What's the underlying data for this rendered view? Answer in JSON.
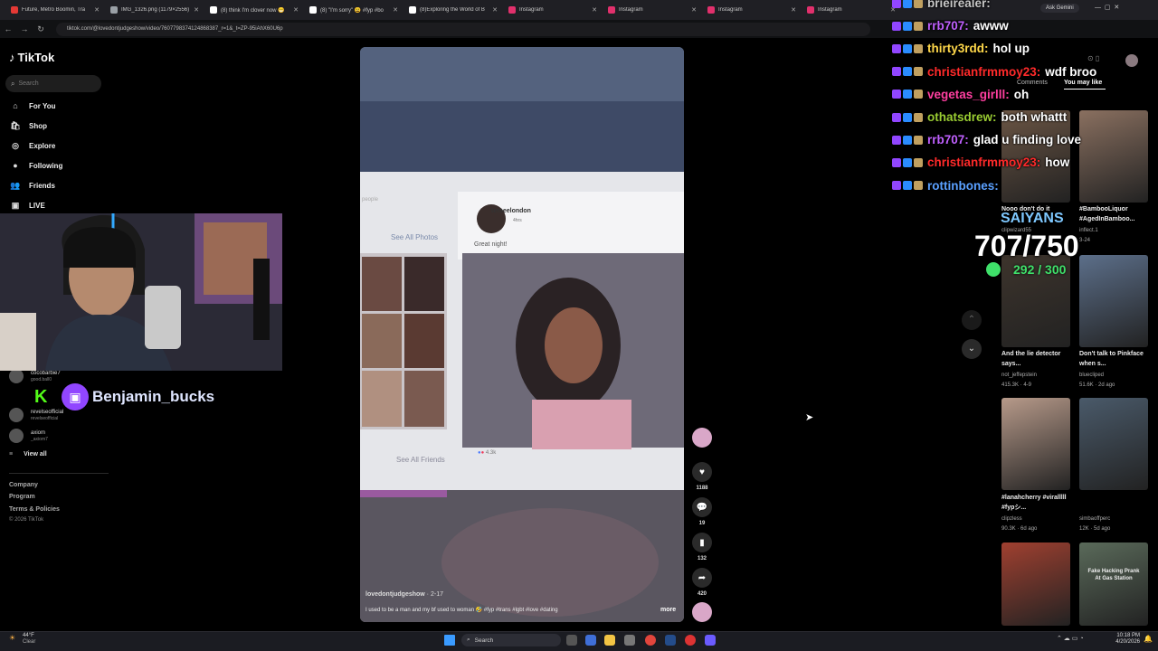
{
  "browser": {
    "tabs": [
      {
        "title": "Future, Metro Boomin, Tra",
        "color": "#e53935"
      },
      {
        "title": "IMG_1326.png (1179×2556)",
        "color": "#9aa0a6"
      },
      {
        "title": "(8) think I'm clover now 😁",
        "color": "#ffffff"
      },
      {
        "title": "(8) \"I'm sorry\" 😩 #fyp #bo",
        "color": "#ffffff"
      },
      {
        "title": "(8)Exploring the World of B",
        "color": "#ffffff"
      },
      {
        "title": "Instagram",
        "color": "#e1306c"
      },
      {
        "title": "Instagram",
        "color": "#e1306c"
      },
      {
        "title": "Instagram",
        "color": "#e1306c"
      },
      {
        "title": "Instagram",
        "color": "#e1306c"
      }
    ],
    "url": "tiktok.com/@lovedontjudgeshow/video/7607798374124868387_r=1&_t=ZP-95iAhX60U6p",
    "ask_gemini": "Ask Gemini"
  },
  "tiktok": {
    "logo": "TikTok",
    "search_placeholder": "Search",
    "nav": [
      {
        "label": "For You",
        "icon": "⌂"
      },
      {
        "label": "Shop",
        "icon": "🛍"
      },
      {
        "label": "Explore",
        "icon": "◎"
      },
      {
        "label": "Following",
        "icon": "●"
      },
      {
        "label": "Friends",
        "icon": "👥"
      },
      {
        "label": "LIVE",
        "icon": "▣"
      }
    ],
    "accounts": [
      {
        "name": "cocobarbie7",
        "sub": "good.ball0"
      },
      {
        "name": "revelseofficial",
        "sub": "revelseofficial"
      },
      {
        "name": "axiom",
        "sub": "_axiom7"
      }
    ],
    "view_all": "View all",
    "footer": [
      "Company",
      "Program",
      "Terms & Policies",
      "© 2026 TikTok"
    ]
  },
  "stream": {
    "streamer_name": "Benjamin_bucks",
    "sub_goal_name": "SAIYANS",
    "sub_goal": "707/750",
    "follow_goal": "292 / 300"
  },
  "video": {
    "post_user": "teraeelondon",
    "post_sub": "4hrs",
    "post_caption": "Great night!",
    "see_all_photos": "See All Photos",
    "see_all_friends": "See All Friends",
    "reactions": "4.3k",
    "people": "people",
    "author": "lovedontjudgeshow",
    "date": "2-17",
    "caption": "I used to be a man and my bf used to woman 🤣 #fyp #trans #lgbt #love #dating",
    "more": "more",
    "likes": "1188",
    "comments": "19",
    "saves": "132",
    "shares": "420"
  },
  "right_panel": {
    "tab_comments": "Comments",
    "tab_you_may_like": "You may like",
    "items": [
      {
        "caption": "Nooo don't do it",
        "user": "clipwizard55",
        "stats": "",
        "color": "#6b5544"
      },
      {
        "caption": "#BambooLiquor #AgedInBamboo...",
        "user": "inflect.1",
        "stats": "3-24",
        "color": "#8a7060"
      },
      {
        "caption": "And the lie detector says...",
        "user": "not_jeffepstein",
        "stats": "415.3K · 4-9",
        "color": "#3d342c"
      },
      {
        "caption": "Don't talk to Pinkface when s...",
        "user": "bluecliped",
        "stats": "51.6K · 2d ago",
        "color": "#5c6f8a"
      },
      {
        "caption": "#lanahcherry #viralllll #fypシ...",
        "user": "clipzless",
        "stats": "90.3K · 6d ago",
        "color": "#b79a8a"
      },
      {
        "caption": "",
        "user": "simbaoffperc",
        "stats": "12K · 5d ago",
        "color": "#4a5a6a"
      },
      {
        "caption": "",
        "user": "",
        "stats": "",
        "color": "#a04030"
      },
      {
        "caption": "Fake Hacking Prank At Gas Station",
        "user": "",
        "stats": "",
        "color": "#5a6a5a"
      }
    ]
  },
  "chat": [
    {
      "user": "brieirealer:",
      "msg": "",
      "color": "#c8c8c8"
    },
    {
      "user": "rrb707:",
      "msg": "awww",
      "color": "#c060ff"
    },
    {
      "user": "thirty3rdd:",
      "msg": "hol up",
      "color": "#ffd84a"
    },
    {
      "user": "christianfrmmoy23:",
      "msg": "wdf broo",
      "color": "#ff2a2a"
    },
    {
      "user": "vegetas_girlll:",
      "msg": "oh",
      "color": "#ff3fa0"
    },
    {
      "user": "othatsdrew:",
      "msg": "both whattt",
      "color": "#9acd32"
    },
    {
      "user": "rrb707:",
      "msg": "glad u finding love",
      "color": "#c060ff"
    },
    {
      "user": "christianfrmmoy23:",
      "msg": "how",
      "color": "#ff2a2a"
    },
    {
      "user": "rottinbones:",
      "msg": "",
      "color": "#5aa0ff"
    }
  ],
  "taskbar": {
    "weather_temp": "44°F",
    "weather_desc": "Clear",
    "search": "Search",
    "time": "10:18 PM",
    "date": "4/20/2026"
  }
}
